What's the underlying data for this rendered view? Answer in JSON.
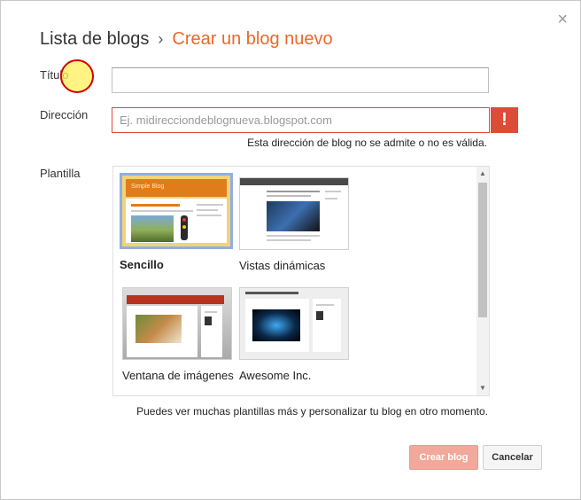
{
  "header": {
    "breadcrumb_parent": "Lista de blogs",
    "separator": "›",
    "current": "Crear un blog nuevo"
  },
  "close_glyph": "×",
  "form": {
    "title_label": "Título",
    "title_value": "",
    "address_label": "Dirección",
    "address_placeholder": "Ej. midirecciondeblognueva.blogspot.com",
    "address_value": "",
    "address_error_icon": "!",
    "address_error_text": "Esta dirección de blog no se admite o no es válida.",
    "template_label": "Plantilla"
  },
  "templates": [
    {
      "name": "Sencillo",
      "selected": true,
      "header_text": "Simple Blog"
    },
    {
      "name": "Vistas dinámicas",
      "selected": false
    },
    {
      "name": "Ventana de imágenes",
      "selected": false
    },
    {
      "name": "Awesome Inc.",
      "selected": false
    }
  ],
  "templates_note": "Puedes ver muchas plantillas más y personalizar tu blog en otro momento.",
  "buttons": {
    "create": "Crear blog",
    "cancel": "Cancelar"
  },
  "colors": {
    "accent": "#e8692a",
    "error": "#dd4b39",
    "create_button_disabled": "#f2a89a",
    "selected_template_border": "#8fb0e0"
  },
  "scrollbar": {
    "up_glyph": "▲",
    "down_glyph": "▼"
  }
}
